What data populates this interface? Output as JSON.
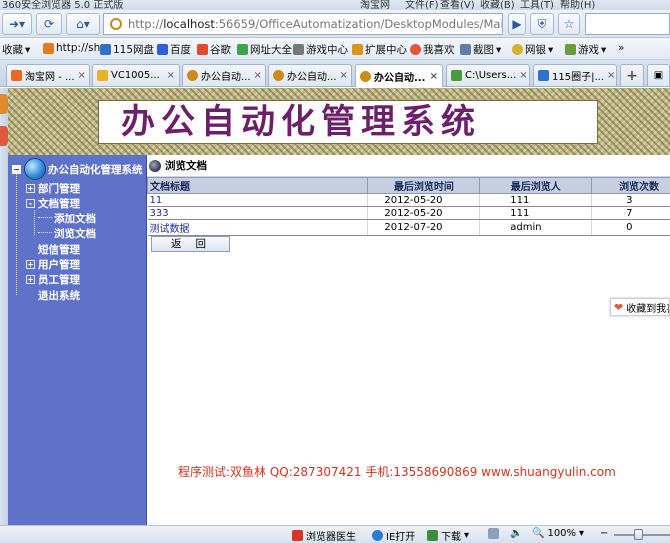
{
  "browser": {
    "title_partial": "360安全浏览器 5.0 正式版",
    "title_right": [
      "淘宝网",
      "文件(F)",
      "查看(V)",
      "收藏(B)",
      "工具(T)",
      "帮助(H)"
    ],
    "url_prefix": "http://",
    "url_host": "localhost",
    "url_rest": ":56659/OfficeAutomatization/DesktopModules/Main.aspx",
    "favorites_label": "收藏",
    "favorites": [
      "http://sh",
      "115网盘",
      "百度",
      "谷歌",
      "网址大全",
      "游戏中心",
      "扩展中心",
      "我喜欢",
      "截图",
      "网银",
      "游戏"
    ],
    "tabs": [
      {
        "label": "淘宝网 - ...",
        "active": false
      },
      {
        "label": "VC1005...",
        "active": false
      },
      {
        "label": "办公自动...",
        "active": false
      },
      {
        "label": "办公自动...",
        "active": false
      },
      {
        "label": "办公自动...",
        "active": true
      },
      {
        "label": "C:\\Users...",
        "active": false
      },
      {
        "label": "115圈子|...",
        "active": false
      }
    ],
    "new_tab_symbol": "+",
    "status": {
      "doctor": "浏览器医生",
      "ie_open": "IE打开",
      "download": "下载",
      "zoom": "100%"
    },
    "float_share": "收藏到我喜"
  },
  "app": {
    "banner_title": "办公自动化管理系统",
    "nav": {
      "root": "办公自动化管理系统",
      "items": [
        {
          "label": "部门管理",
          "level": 1,
          "expander": "+"
        },
        {
          "label": "文档管理",
          "level": 1,
          "expander": "-"
        },
        {
          "label": "添加文档",
          "level": 2,
          "expander": ""
        },
        {
          "label": "浏览文档",
          "level": 2,
          "expander": ""
        },
        {
          "label": "短信管理",
          "level": 1,
          "expander": ""
        },
        {
          "label": "用户管理",
          "level": 1,
          "expander": "+"
        },
        {
          "label": "员工管理",
          "level": 1,
          "expander": "+"
        },
        {
          "label": "退出系统",
          "level": 1,
          "expander": ""
        }
      ]
    },
    "content": {
      "header": "浏览文档",
      "columns": [
        "文档标题",
        "最后浏览时间",
        "最后浏览人",
        "浏览次数"
      ],
      "rows": [
        [
          "11",
          "2012-05-20",
          "111",
          "3"
        ],
        [
          "333",
          "2012-05-20",
          "111",
          "7"
        ],
        [
          "测试数据",
          "2012-07-20",
          "admin",
          "0"
        ]
      ],
      "back_button": "返回",
      "credit": "程序测试:双鱼林 QQ:287307421 手机:13558690869 www.shuangyulin.com"
    }
  }
}
